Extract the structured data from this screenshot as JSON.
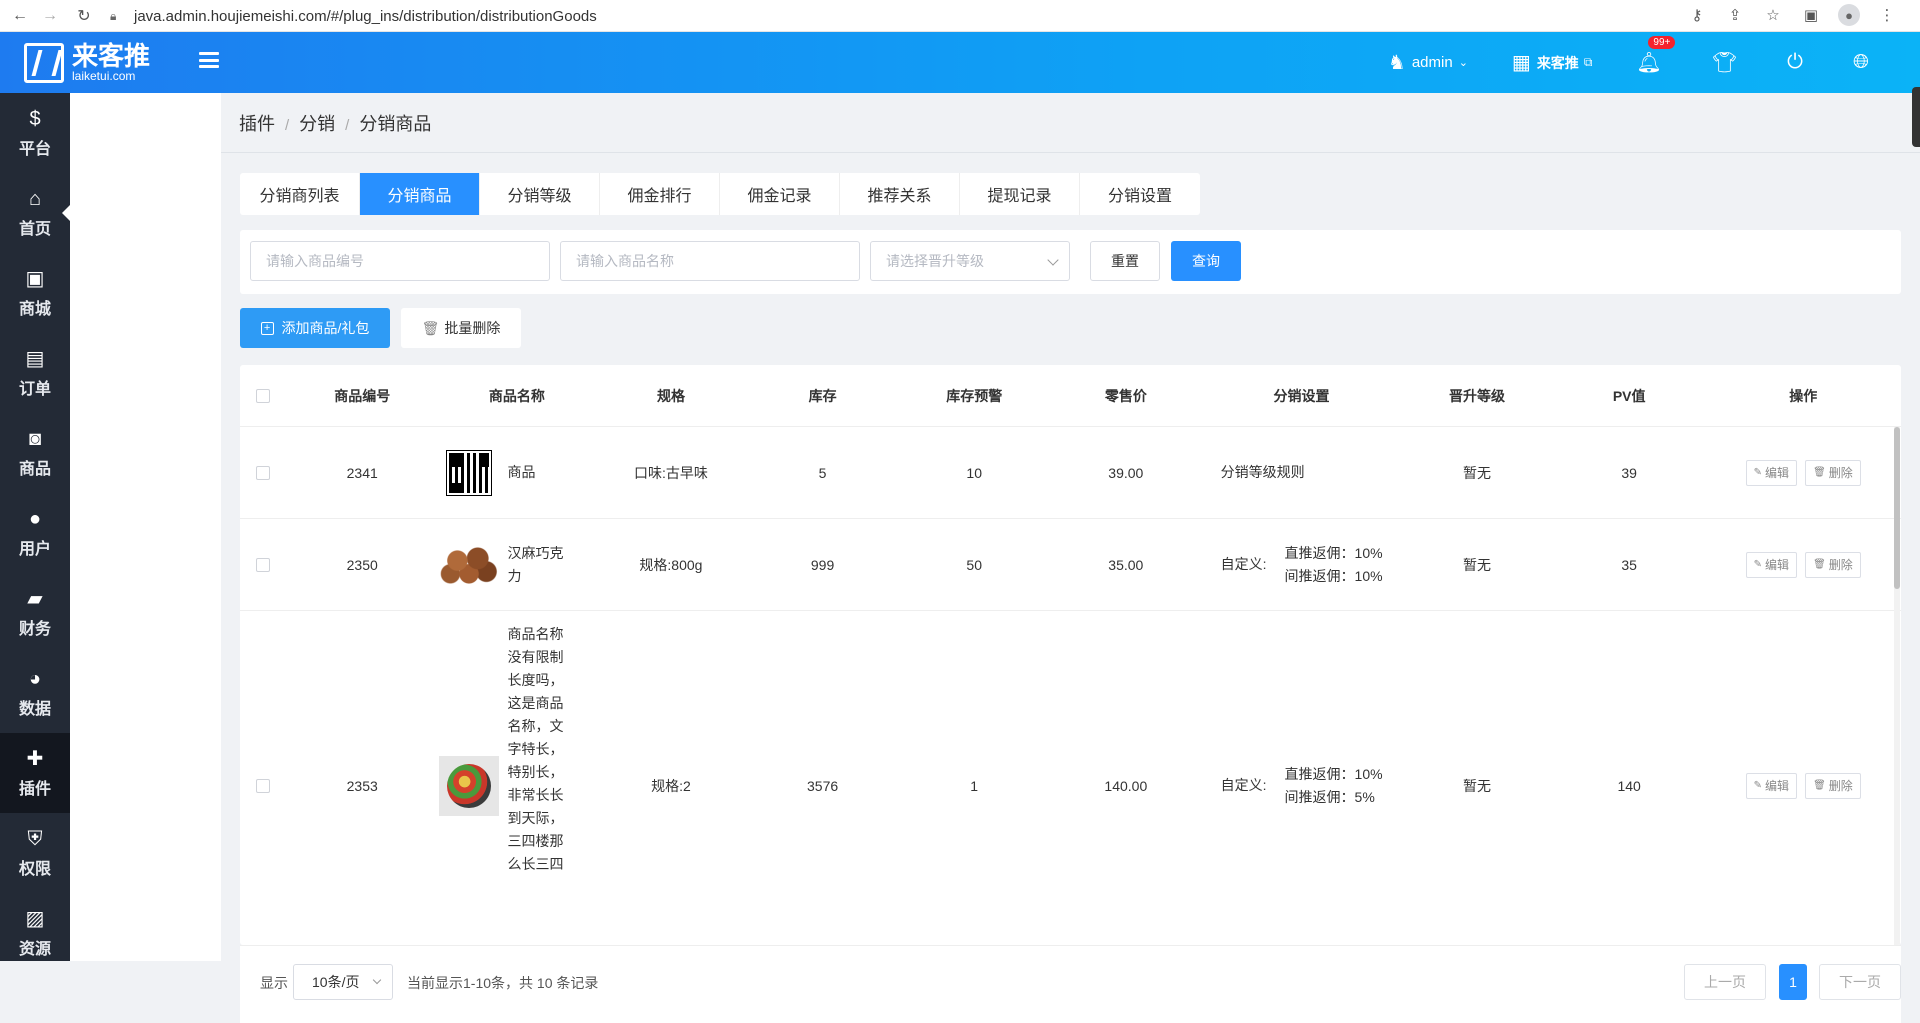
{
  "browser": {
    "url": "java.admin.houjiemeishi.com/#/plug_ins/distribution/distributionGoods"
  },
  "header": {
    "logo_name": "来客推",
    "logo_sub": "laiketui.com",
    "user": "admin",
    "store": "来客推",
    "notif_badge": "99+"
  },
  "sidebar": {
    "items": [
      {
        "label": "平台",
        "icon": "dollar-icon"
      },
      {
        "label": "首页",
        "icon": "home-icon"
      },
      {
        "label": "商城",
        "icon": "store-icon"
      },
      {
        "label": "订单",
        "icon": "clipboard-icon"
      },
      {
        "label": "商品",
        "icon": "bag-icon"
      },
      {
        "label": "用户",
        "icon": "user-icon"
      },
      {
        "label": "财务",
        "icon": "wallet-icon"
      },
      {
        "label": "数据",
        "icon": "pie-icon"
      },
      {
        "label": "插件",
        "icon": "puzzle-icon"
      },
      {
        "label": "权限",
        "icon": "shield-icon"
      },
      {
        "label": "资源",
        "icon": "image-icon"
      }
    ]
  },
  "breadcrumb": [
    "插件",
    "分销",
    "分销商品"
  ],
  "tabs": [
    "分销商列表",
    "分销商品",
    "分销等级",
    "佣金排行",
    "佣金记录",
    "推荐关系",
    "提现记录",
    "分销设置"
  ],
  "filter": {
    "code_placeholder": "请输入商品编号",
    "name_placeholder": "请输入商品名称",
    "level_placeholder": "请选择晋升等级",
    "reset": "重置",
    "query": "查询"
  },
  "actions": {
    "add": "添加商品/礼包",
    "batch_delete": "批量删除"
  },
  "table": {
    "headers": [
      "商品编号",
      "商品名称",
      "规格",
      "库存",
      "库存预警",
      "零售价",
      "分销设置",
      "晋升等级",
      "PV值",
      "操作"
    ],
    "edit": "编辑",
    "delete": "删除",
    "rows": [
      {
        "code": "2341",
        "name": "商品",
        "spec": "口味:古早味",
        "stock": "5",
        "warn": "10",
        "price": "39.00",
        "dist_pre": "",
        "dist_l1": "分销等级规则",
        "dist_l2": "",
        "level": "暂无",
        "pv": "39"
      },
      {
        "code": "2350",
        "name": "汉麻巧克力",
        "spec": "规格:800g",
        "stock": "999",
        "warn": "50",
        "price": "35.00",
        "dist_pre": "自定义:",
        "dist_l1": "直推返佣：10%",
        "dist_l2": "间推返佣：10%",
        "level": "暂无",
        "pv": "35"
      },
      {
        "code": "2353",
        "name": "商品名称没有限制长度吗，这是商品名称，文字特长，特别长，非常长长到天际，三四楼那么长三四",
        "spec": "规格:2",
        "stock": "3576",
        "warn": "1",
        "price": "140.00",
        "dist_pre": "自定义:",
        "dist_l1": "直推返佣：10%",
        "dist_l2": "间推返佣：5%",
        "level": "暂无",
        "pv": "140"
      }
    ]
  },
  "pager": {
    "show": "显示",
    "size": "10条/页",
    "info": "当前显示1-10条，共 10 条记录",
    "prev": "上一页",
    "page": "1",
    "next": "下一页"
  }
}
